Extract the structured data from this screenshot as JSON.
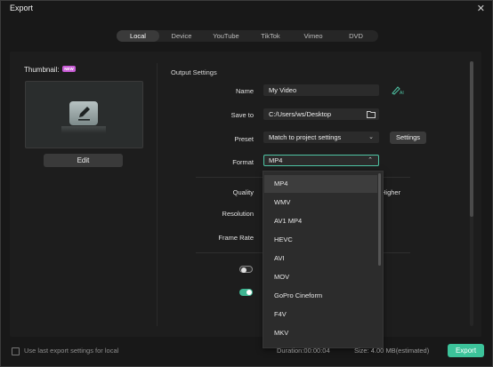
{
  "window": {
    "title": "Export",
    "close": "✕"
  },
  "tabs": [
    {
      "label": "Local",
      "active": true
    },
    {
      "label": "Device"
    },
    {
      "label": "YouTube"
    },
    {
      "label": "TikTok"
    },
    {
      "label": "Vimeo"
    },
    {
      "label": "DVD"
    }
  ],
  "thumbnail": {
    "label": "Thumbnail:",
    "badge": "NEW",
    "edit_label": "Edit"
  },
  "output": {
    "section_title": "Output Settings",
    "name_label": "Name",
    "name_value": "My Video",
    "save_label": "Save to",
    "save_value": "C:/Users/ws/Desktop",
    "preset_label": "Preset",
    "preset_value": "Match to project settings",
    "settings_button": "Settings",
    "format_label": "Format",
    "format_value": "MP4",
    "quality_label": "Quality",
    "quality_right": "Higher",
    "resolution_label": "Resolution",
    "framerate_label": "Frame Rate"
  },
  "format_options": [
    "MP4",
    "WMV",
    "AV1 MP4",
    "HEVC",
    "AVI",
    "MOV",
    "GoPro Cineform",
    "F4V",
    "MKV"
  ],
  "footer": {
    "use_last_label": "Use last export settings for local",
    "duration": "Duration:00:00:04",
    "size": "Size: 4.00 MB(estimated)",
    "export_label": "Export"
  },
  "colors": {
    "accent": "#3cc39a",
    "badge": "#c85cd6"
  },
  "icons": {
    "edit": "pencil-icon",
    "folder": "folder-icon",
    "ai": "ai-pen-icon",
    "close": "close-icon"
  }
}
